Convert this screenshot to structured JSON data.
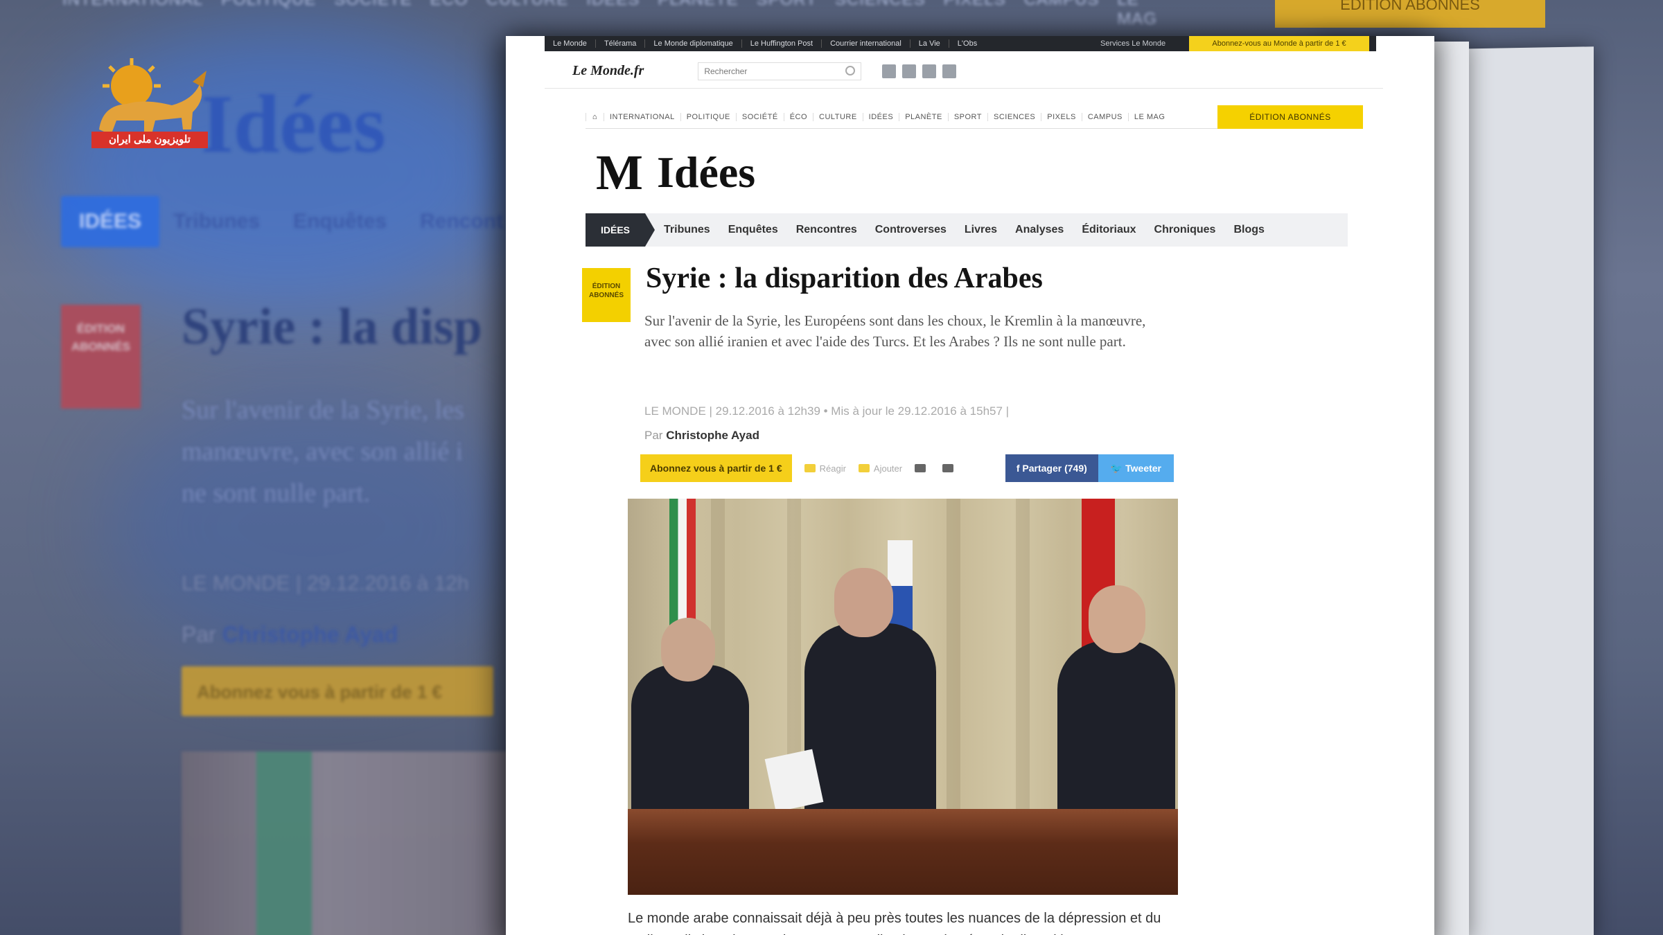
{
  "background": {
    "topnav": [
      "INTERNATIONAL",
      "POLITIQUE",
      "SOCIÉTÉ",
      "ÉCO",
      "CULTURE",
      "IDÉES",
      "PLANÈTE",
      "SPORT",
      "SCIENCES",
      "PIXELS",
      "CAMPUS",
      "LE MAG"
    ],
    "topnav_button": "ÉDITION ABONNÉS",
    "title": "Idées",
    "nav_active": "IDÉES",
    "nav": [
      "Tribunes",
      "Enquêtes",
      "Rencont"
    ],
    "badge": "ÉDITION ABONNÉS",
    "headline": "Syrie : la disp",
    "sub_line1": "Sur l'avenir de la Syrie, les",
    "sub_line2": "manœuvre, avec son allié i",
    "sub_line3": "ne sont nulle part.",
    "meta": "LE MONDE | 29.12.2016 à 12h",
    "by_prefix": "Par",
    "author": "Christophe Ayad",
    "subscribe": "Abonnez vous à partir de 1 €"
  },
  "logo": {
    "caption": "تلویزیون ملی ایران",
    "icon": "lion-sun-emblem"
  },
  "topstrip": {
    "links": [
      "Le Monde",
      "Télérama",
      "Le Monde diplomatique",
      "Le Huffington Post",
      "Courrier international",
      "La Vie",
      "L'Obs"
    ],
    "services": "Services Le Monde",
    "subscribe": "Abonnez-vous au Monde à partir de 1 €"
  },
  "lmbar": {
    "logo": "Le Monde.fr",
    "tagline": "",
    "search_placeholder": "Rechercher",
    "right": [
      "",
      "",
      ""
    ]
  },
  "nav2": {
    "items": [
      "INTERNATIONAL",
      "POLITIQUE",
      "SOCIÉTÉ",
      "ÉCO",
      "CULTURE",
      "IDÉES",
      "PLANÈTE",
      "SPORT",
      "SCIENCES",
      "PIXELS",
      "CAMPUS",
      "LE MAG"
    ],
    "edition": "ÉDITION ABONNÉS"
  },
  "section": {
    "logo_m": "M",
    "title": "Idées"
  },
  "nav3": {
    "active": "IDÉES",
    "items": [
      "Tribunes",
      "Enquêtes",
      "Rencontres",
      "Controverses",
      "Livres",
      "Analyses",
      "Éditoriaux",
      "Chroniques",
      "Blogs"
    ]
  },
  "article": {
    "badge": "ÉDITION ABONNÉS",
    "headline": "Syrie : la disparition des Arabes",
    "lead": "Sur l'avenir de la Syrie, les Européens sont dans les choux, le Kremlin à la manœuvre, avec son allié iranien et avec l'aide des Turcs. Et les Arabes ? Ils ne sont nulle part.",
    "meta": "LE MONDE | 29.12.2016 à 12h39 • Mis à jour le 29.12.2016 à 15h57 |",
    "by_prefix": "Par",
    "author": "Christophe Ayad",
    "subscribe_button": "Abonnez vous à partir de 1 €",
    "action_labels": [
      "Réagir",
      "Ajouter"
    ],
    "facebook": "Partager (749)",
    "twitter": "Tweeter",
    "body": "Le monde arabe connaissait déjà à peu près toutes les nuances de la dépression et du malheur, il vient d'entrer dans une nouvelle phase : le néant, la disparition"
  }
}
